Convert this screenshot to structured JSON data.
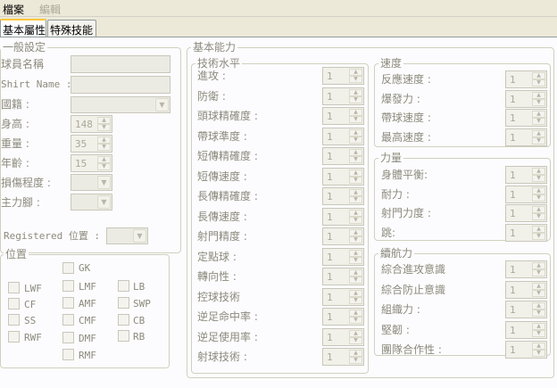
{
  "menu": {
    "file": "檔案",
    "edit": "編輯"
  },
  "tabs": {
    "basic": "基本屬性",
    "skills": "特殊技能"
  },
  "general": {
    "title": "一般設定",
    "player_name": "球員名稱",
    "shirt_name": "Shirt Name :",
    "nationality": "國籍 :",
    "height": "身高 :",
    "height_value": "148",
    "weight": "重量 :",
    "weight_value": "35",
    "age": "年齡 :",
    "age_value": "15",
    "injury": "損傷程度 :",
    "foot": "主力腳 :"
  },
  "registered_position": "Registered 位置 :",
  "position": {
    "title": "位置",
    "labels": [
      "GK",
      "LWF",
      "LMF",
      "LB",
      "CF",
      "AMF",
      "SWP",
      "SS",
      "CMF",
      "CB",
      "RWF",
      "DMF",
      "RB",
      "RMF"
    ]
  },
  "ability": {
    "title": "基本能力",
    "technique": {
      "title": "技術水平",
      "rows": [
        {
          "label": "進攻 :",
          "value": "1"
        },
        {
          "label": "防衛 :",
          "value": "1"
        },
        {
          "label": "頭球精確度 :",
          "value": "1"
        },
        {
          "label": "帶球準度 :",
          "value": "1"
        },
        {
          "label": "短傳精確度 :",
          "value": "1"
        },
        {
          "label": "短傳速度 :",
          "value": "1"
        },
        {
          "label": "長傳精確度 :",
          "value": "1"
        },
        {
          "label": "長傳速度 :",
          "value": "1"
        },
        {
          "label": "射門精度 :",
          "value": "1"
        },
        {
          "label": "定點球 :",
          "value": "1"
        },
        {
          "label": "轉向性 :",
          "value": "1"
        },
        {
          "label": "控球技術",
          "value": "1"
        },
        {
          "label": "逆足命中率 :",
          "value": "1"
        },
        {
          "label": "逆足使用率 :",
          "value": "1"
        },
        {
          "label": "射球技術 :",
          "value": "1"
        }
      ]
    },
    "speed": {
      "title": "速度",
      "rows": [
        {
          "label": "反應速度 :",
          "value": "1"
        },
        {
          "label": "爆發力 :",
          "value": "1"
        },
        {
          "label": "帶球速度 :",
          "value": "1"
        },
        {
          "label": "最高速度 :",
          "value": "1"
        }
      ]
    },
    "power": {
      "title": "力量",
      "rows": [
        {
          "label": "身體平衡:",
          "value": "1"
        },
        {
          "label": "耐力 :",
          "value": "1"
        },
        {
          "label": "射門力度 :",
          "value": "1"
        },
        {
          "label": "跳:",
          "value": "1"
        }
      ]
    },
    "endurance": {
      "title": "續航力",
      "rows": [
        {
          "label": "綜合進攻意識",
          "value": "1"
        },
        {
          "label": "綜合防止意識",
          "value": "1"
        },
        {
          "label": "組織力 :",
          "value": "1"
        },
        {
          "label": "堅韌 :",
          "value": "1"
        },
        {
          "label": "團隊合作性 :",
          "value": "1"
        }
      ]
    }
  }
}
